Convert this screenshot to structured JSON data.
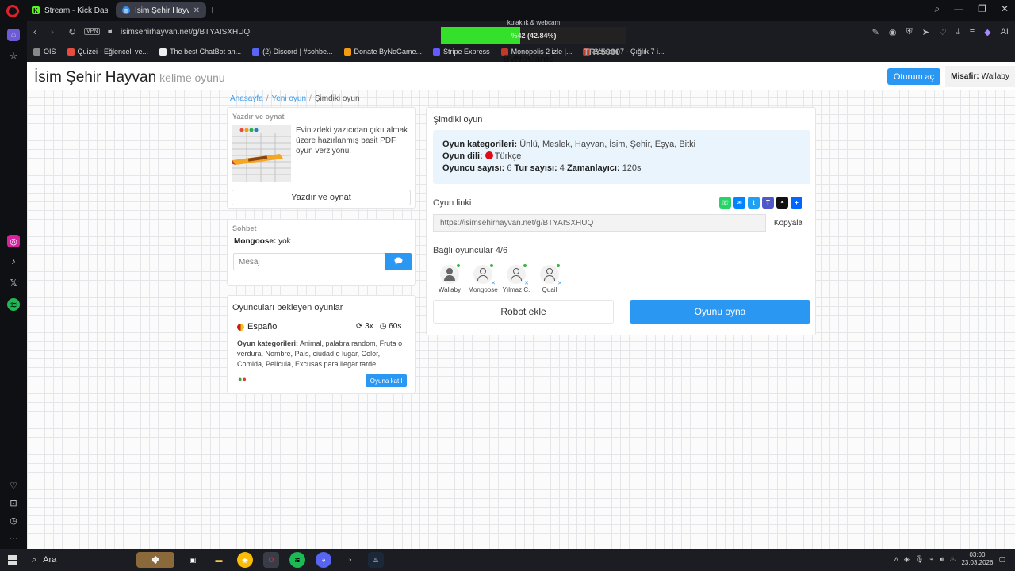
{
  "browser": {
    "tabs": [
      {
        "label": "Stream - Kick Dashboard",
        "favicon_color": "#53fc18",
        "favicon_glyph": "K"
      },
      {
        "label": "İsim Şehir Hayvan oyu",
        "favicon_color": "#3a8ee6",
        "favicon_glyph": "◍"
      }
    ],
    "url": "isimsehirhayvan.net/g/BTYAISXHUQ",
    "vpn_label": "VPN",
    "bookmarks": [
      "OIS",
      "Quizei - Eğlenceli ve...",
      "The best ChatBot an...",
      "(2) Discord | #sohbe...",
      "Donate ByNoGame...",
      "Stripe Express",
      "Monopolis 2 izle |...",
      "Scream 7 - Çığlık 7 i..."
    ],
    "toolbar_ai": "AI"
  },
  "stream_overlay": {
    "title": "kulaklık & webcam",
    "progress_text": "%42 (42.84%)",
    "progress_fraction": 0.4284,
    "logo": "ByNoGame",
    "code": "TRY5000",
    "bar_color": "#35e02a"
  },
  "site": {
    "title": "İsim Şehir Hayvan",
    "subtitle": "kelime oyunu",
    "login_label": "Oturum aç",
    "guest_label": "Misafir:",
    "guest_name": "Wallaby"
  },
  "breadcrumb": {
    "home": "Anasayfa",
    "new_game": "Yeni oyun",
    "current": "Şimdiki oyun"
  },
  "print_card": {
    "title": "Yazdır ve oynat",
    "text": "Evinizdeki yazıcıdan çıktı almak üzere hazırlanmış basit PDF oyun verziyonu.",
    "button": "Yazdır ve oynat"
  },
  "chat": {
    "title": "Sohbet",
    "author": "Mongoose:",
    "message": "yok",
    "placeholder": "Mesaj"
  },
  "waiting": {
    "title": "Oyuncuları bekleyen oyunlar",
    "language": "Español",
    "rounds": "3x",
    "timer": "60s",
    "categories_label": "Oyun kategorileri:",
    "categories": "Animal, palabra random, Fruta o verdura, Nombre, País, ciudad o lugar, Color, Comida, Película, Excusas para llegar tarde",
    "join_label": "Oyuna katıl"
  },
  "current_game": {
    "title": "Şimdiki oyun",
    "categories_label": "Oyun kategorileri:",
    "categories": "Ünlü, Meslek, Hayvan, İsim, Şehir, Eşya, Bitki",
    "language_label": "Oyun dili:",
    "language": "Türkçe",
    "players_label": "Oyuncu sayısı:",
    "players": "6",
    "rounds_label": "Tur sayısı:",
    "rounds": "4",
    "timer_label": "Zamanlayıcı:",
    "timer": "120s",
    "link_label": "Oyun linki",
    "link": "https://isimsehirhayvan.net/g/BTYAISXHUQ",
    "copy_label": "Kopyala",
    "connected_label": "Bağlı oyuncular 4/6",
    "connected_players": [
      "Wallaby",
      "Mongoose",
      "Yılmaz C.",
      "Quail"
    ],
    "robot_label": "Robot ekle",
    "play_label": "Oyunu oyna"
  },
  "taskbar": {
    "search_label": "Ara",
    "time": "03:00",
    "date": "23.03.2026"
  },
  "colors": {
    "accent": "#2a97f3",
    "info_bg": "#e9f4fd",
    "online": "#3cb548"
  }
}
